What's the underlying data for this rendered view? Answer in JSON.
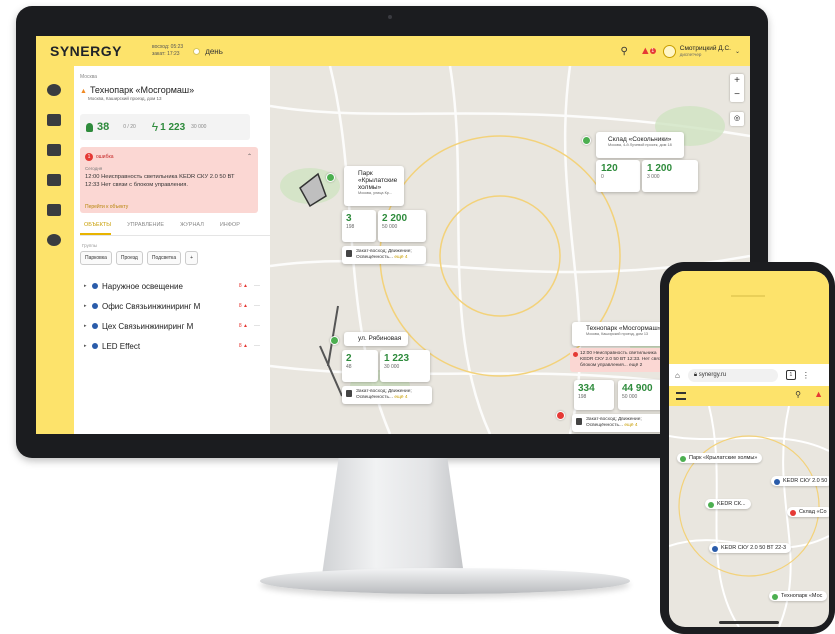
{
  "topbar": {
    "logo": "SYNERGY",
    "sunrise": "восход: 05:23",
    "sunset": "закат: 17:23",
    "day_mode": "день",
    "user_name": "Смотрицкий Д.С.",
    "user_role": "диспетчер",
    "alert_count": "1"
  },
  "panel": {
    "breadcrumb": "Москва",
    "title": "Технопарк «Мосгормаш»",
    "address": "Москва, Каширский проезд, дом 13",
    "stat_lamps": "38",
    "stat_lamps_small": "0 / 20",
    "stat_power": "1 223",
    "stat_power_small": "30 000",
    "error": {
      "count": "1",
      "heading": "ошибка",
      "sub": "Сегодня",
      "message": "12:00 Неисправность светильника KEDR СКУ 2.0 50 ВТ 12:33 Нет связи с блоком управления.",
      "link": "Перейти к объекту"
    },
    "tabs": [
      "ОБЪЕКТЫ",
      "УПРАВЛЕНИЕ",
      "ЖУРНАЛ",
      "ИНФОР"
    ],
    "groups_label": "Группы",
    "chips": [
      "Парковка",
      "Проезд",
      "Подсветка",
      "+"
    ],
    "tree": [
      {
        "label": "Наружное освещение",
        "status": "8 ▲"
      },
      {
        "label": "Офис Связьинжиниринг М",
        "status": "8 ▲"
      },
      {
        "label": "Цех Связьинжиниринг М",
        "status": "8 ▲"
      },
      {
        "label": "LED Effect",
        "status": "8 ▲"
      }
    ],
    "collapse": "‹"
  },
  "map": {
    "zoom_in": "+",
    "zoom_out": "−",
    "locate": "◎",
    "sites": [
      {
        "title": "Склад «Сокольники»",
        "address": "Москва, 4-й Лучевой просек, дом 18",
        "lamps": "120",
        "lamps_small": "0",
        "power": "1 200",
        "power_small": "3 000"
      },
      {
        "title": "Парк «Крылатские холмы»",
        "address": "Москва, улица Кр...",
        "lamps": "3",
        "lamps_small": "198",
        "power": "2 200",
        "power_small": "50 000",
        "scenario": "Закат-восход; Движение; Освещённость...",
        "more": "ещё 4"
      },
      {
        "title": "ул. Рябиновая",
        "lamps": "2",
        "lamps_small": "48",
        "power": "1 223",
        "power_small": "30 000",
        "scenario": "Закат-восход; Движение; Освещённость...",
        "more": "ещё 4"
      },
      {
        "title": "Технопарк «Мосгормаш»",
        "address": "Москва, Каширский проезд, дом 13",
        "error": "12:00 Неисправность светильника KEDR СКУ 2.0 50 ВТ 12:33. Нет связи с блоком управления...",
        "error_more": "ещё 2",
        "lamps": "334",
        "lamps_small": "198",
        "power": "44 900",
        "power_small": "50 000",
        "scenario": "Закат-восход; Движение; Освещённость...",
        "more": "ещё 4"
      }
    ]
  },
  "phone": {
    "url": "synergy.ru",
    "tabs_count": "1",
    "labels": [
      "Парк «Крылатские холмы»",
      "KEDR СКУ 2.0 50",
      "KEDR СК...",
      "Склад «Со",
      "KEDR СКУ 2.0 50 ВТ 22-3",
      "Технопарк «Мос"
    ]
  },
  "colors": {
    "brand_yellow": "#fde36b",
    "accent_green": "#2e8b3c",
    "error_red": "#e53935",
    "error_bg": "#fbd7d3"
  }
}
